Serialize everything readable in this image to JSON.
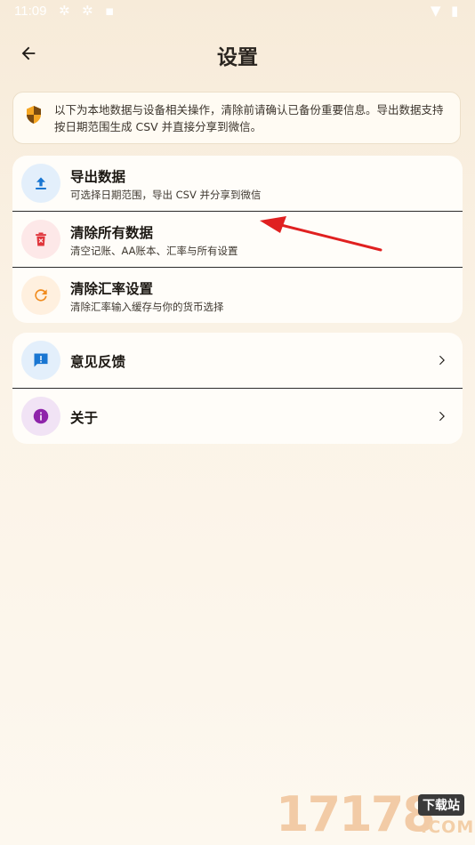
{
  "status_bar": {
    "time": "11:09"
  },
  "header": {
    "title": "设置"
  },
  "notice": {
    "text": "以下为本地数据与设备相关操作，清除前请确认已备份重要信息。导出数据支持按日期范围生成 CSV 并直接分享到微信。"
  },
  "data_section": {
    "items": [
      {
        "icon": "upload-icon",
        "title": "导出数据",
        "subtitle": "可选择日期范围，导出 CSV 并分享到微信",
        "icon_color": "#1976d2",
        "icon_bg": "#e3effb"
      },
      {
        "icon": "trash-icon",
        "title": "清除所有数据",
        "subtitle": "清空记账、AA账本、汇率与所有设置",
        "icon_color": "#e0353b",
        "icon_bg": "#fde8e8"
      },
      {
        "icon": "refresh-icon",
        "title": "清除汇率设置",
        "subtitle": "清除汇率输入缓存与你的货币选择",
        "icon_color": "#f08a1c",
        "icon_bg": "#fff0df"
      }
    ]
  },
  "misc_section": {
    "items": [
      {
        "icon": "feedback-icon",
        "title": "意见反馈",
        "icon_color": "#1976d2",
        "icon_bg": "#e3effb"
      },
      {
        "icon": "info-icon",
        "title": "关于",
        "icon_color": "#8e24aa",
        "icon_bg": "#f1e3f5"
      }
    ]
  },
  "watermark": {
    "digits": "17178",
    "badge": "下载站",
    "domain": ".COM"
  },
  "colors": {
    "annotation_arrow": "#e02020",
    "shield_accent": "#f5a623"
  }
}
